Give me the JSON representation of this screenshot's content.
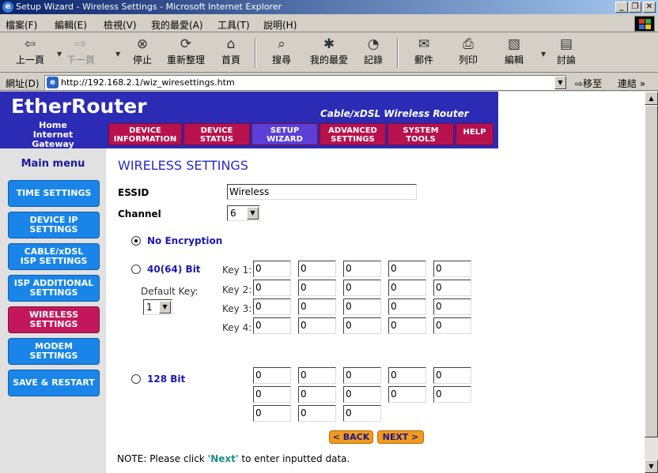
{
  "window": {
    "title": "Setup Wizard - Wireless Settings - Microsoft Internet Explorer"
  },
  "menu": [
    "檔案(F)",
    "編輯(E)",
    "檢視(V)",
    "我的最愛(A)",
    "工具(T)",
    "說明(H)"
  ],
  "toolbar": {
    "back": "上一頁",
    "forward": "下一頁",
    "stop": "停止",
    "refresh": "重新整理",
    "home": "首頁",
    "search": "搜尋",
    "favorites": "我的最愛",
    "history": "記錄",
    "mail": "郵件",
    "print": "列印",
    "edit": "編輯",
    "discuss": "討論"
  },
  "address": {
    "label": "網址(D)",
    "url": "http://192.168.2.1/wiz_wiresettings.htm",
    "go": "移至",
    "links": "連結 »"
  },
  "header": {
    "logo": "EtherRouter",
    "subtitle": "Cable/xDSL Wireless Router",
    "logo_sub": "Home Internet Gateway",
    "tabs": [
      {
        "l1": "DEVICE",
        "l2": "INFORMATION"
      },
      {
        "l1": "DEVICE",
        "l2": "STATUS"
      },
      {
        "l1": "SETUP",
        "l2": "WIZARD"
      },
      {
        "l1": "ADVANCED",
        "l2": "SETTINGS"
      },
      {
        "l1": "SYSTEM",
        "l2": "TOOLS"
      },
      {
        "l1": "HELP",
        "l2": ""
      }
    ]
  },
  "sidebar": {
    "title": "Main menu",
    "items": [
      {
        "label": "TIME SETTINGS"
      },
      {
        "label": "DEVICE IP SETTINGS"
      },
      {
        "label": "CABLE/xDSL ISP SETTINGS"
      },
      {
        "label": "ISP ADDITIONAL SETTINGS"
      },
      {
        "label": "WIRELESS SETTINGS"
      },
      {
        "label": "MODEM SETTINGS"
      },
      {
        "label": "SAVE & RESTART"
      }
    ]
  },
  "main": {
    "title": "WIRELESS SETTINGS",
    "essid_label": "ESSID",
    "essid_value": "Wireless",
    "channel_label": "Channel",
    "channel_value": "6",
    "no_encryption": "No Encryption",
    "bit40": "40(64) Bit",
    "default_key_label": "Default Key:",
    "default_key_value": "1",
    "key_labels": [
      "Key 1:",
      "Key 2:",
      "Key 3:",
      "Key 4:"
    ],
    "key_value": "0",
    "bit128": "128 Bit",
    "back_button": "< BACK",
    "next_button": "NEXT >",
    "note_prefix": "NOTE: Please click ",
    "note_next": "'Next'",
    "note_suffix": " to enter inputted data."
  }
}
